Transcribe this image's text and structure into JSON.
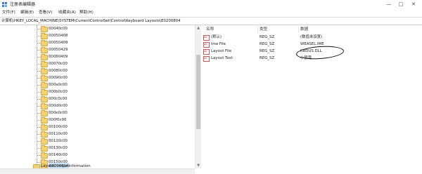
{
  "window": {
    "title": "注册表编辑器",
    "controls": {
      "minimize": "—",
      "maximize": "□",
      "close": "✕"
    }
  },
  "menu": {
    "file": "文件(F)",
    "edit": "编辑(E)",
    "view": "查看(V)",
    "favorites": "收藏夹(A)",
    "help": "帮助(H)"
  },
  "address": "计算机\\HKEY_LOCAL_MACHINE\\SYSTEM\\CurrentControlSet\\Control\\Keyboard Layouts\\E0200804",
  "tree": {
    "nodes": [
      "00040c00",
      "00050408",
      "00050409",
      "00050429",
      "00060409",
      "00070c00",
      "00080c00",
      "00090c00",
      "000a0c00",
      "000b0c00",
      "000c0c00",
      "000d0c00",
      "000e0c00",
      "000f0c00",
      "00100c00",
      "00110c00",
      "00120c00",
      "00130c00",
      "00140c00",
      "00150c00",
      "E0200804"
    ],
    "selected": "E0200804",
    "last_partial": "LayoutCompatInformation"
  },
  "list": {
    "headers": {
      "name": "名称",
      "type": "类型",
      "data": "数据"
    },
    "rows": [
      {
        "name": "(默认)",
        "type": "REG_SZ",
        "data": "(数值未设置)"
      },
      {
        "name": "Ime File",
        "type": "REG_SZ",
        "data": "WEASEL.IME"
      },
      {
        "name": "Layout File",
        "type": "REG_SZ",
        "data": "KBDUS.DLL"
      },
      {
        "name": "Layout Text",
        "type": "REG_SZ",
        "data": "小狼毫"
      }
    ]
  },
  "icons": {
    "app": "regedit-icon",
    "folder": "folder-icon",
    "value": "string-value-icon"
  },
  "colors": {
    "selection": "#cde3f8",
    "folder": "#f2d17a",
    "annotation": "#111111"
  }
}
